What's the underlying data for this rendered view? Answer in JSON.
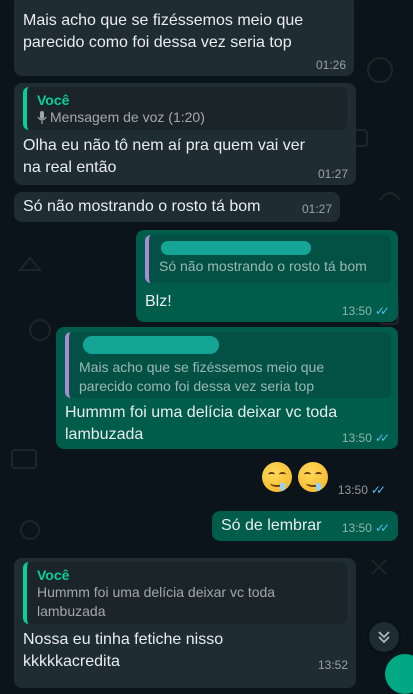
{
  "messages": [
    {
      "id": "m1",
      "dir": "in",
      "text": "Mais acho que se fizéssemos meio que\nparecido como foi dessa vez seria top",
      "time": "01:26"
    },
    {
      "id": "m2",
      "dir": "in",
      "quote_author": "Você",
      "quote_text": "Mensagem de voz (1:20)",
      "text": "Olha eu não tô nem aí pra quem vai ver\nna real então",
      "time": "01:27"
    },
    {
      "id": "m3",
      "dir": "in",
      "text": "Só não mostrando o rosto tá bom",
      "time": "01:27"
    },
    {
      "id": "m4",
      "dir": "out",
      "quote_text": "Só não mostrando o rosto tá bom",
      "text": "Blz!",
      "time": "13:50"
    },
    {
      "id": "m5",
      "dir": "out",
      "quote_text": "Mais acho que se fizéssemos meio que\nparecido como foi dessa vez seria top",
      "text": "Hummm foi uma delícia deixar vc toda\nlambuzada",
      "time": "13:50"
    },
    {
      "id": "m6",
      "dir": "out",
      "emoji": "🤤🤤",
      "time": "13:50"
    },
    {
      "id": "m7",
      "dir": "out",
      "text": "Só de lembrar",
      "time": "13:50"
    },
    {
      "id": "m8",
      "dir": "in",
      "quote_author": "Você",
      "quote_text": "Hummm foi uma delícia deixar vc toda\nlambuzada",
      "text": "Nossa eu tinha fetiche nisso\nkkkkkacredita",
      "time": "13:52"
    }
  ],
  "ticks_symbol": "✓✓",
  "scroll_icon": "chevron-double-down-icon",
  "mic_icon": "mic-icon",
  "colors": {
    "incoming": "#202c33",
    "outgoing": "#005c4b",
    "read_ticks": "#53bdeb",
    "you_label": "#06cf9c"
  }
}
